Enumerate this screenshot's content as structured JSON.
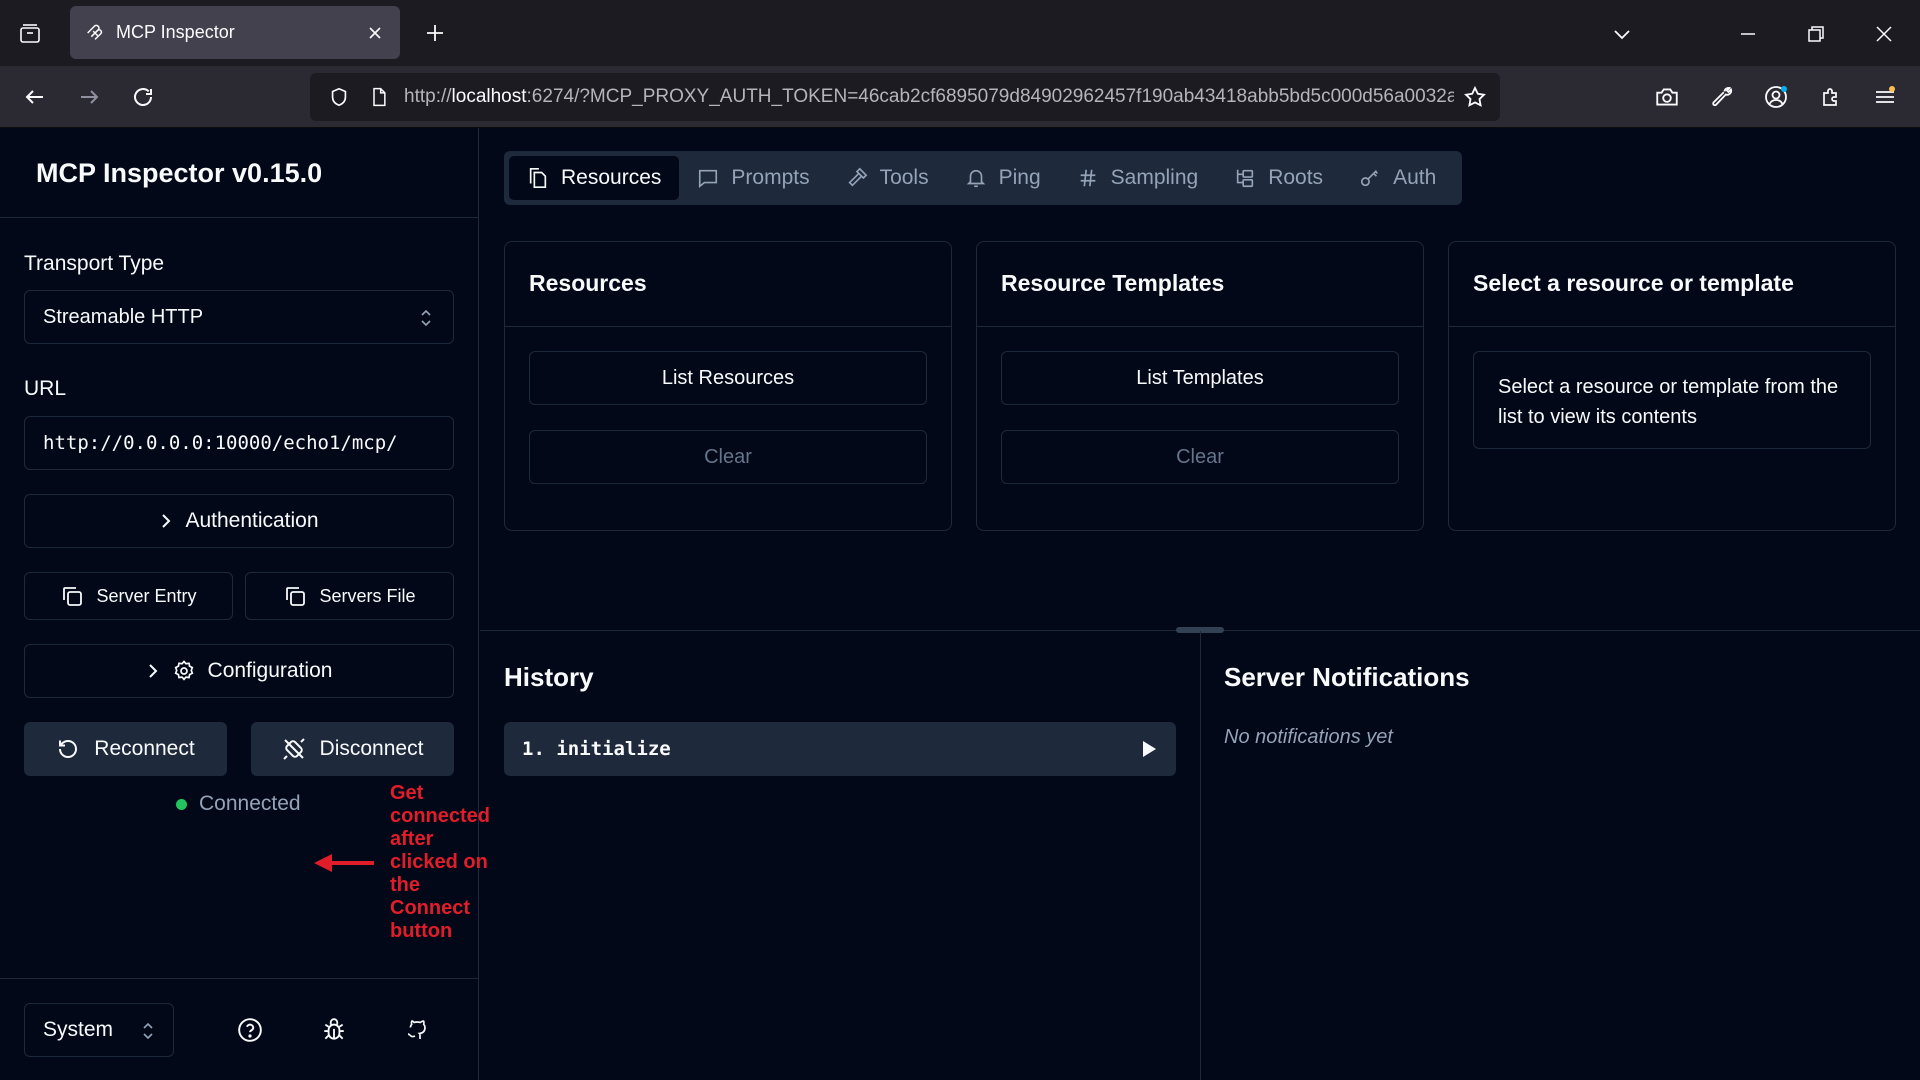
{
  "browser": {
    "tab_title": "MCP Inspector",
    "url_prefix": "http://",
    "url_host": "localhost",
    "url_rest": ":6274/?MCP_PROXY_AUTH_TOKEN=46cab2cf6895079d84902962457f190ab43418abb5bd5c000d56a0032a"
  },
  "sidebar": {
    "title": "MCP Inspector v0.15.0",
    "transport_label": "Transport Type",
    "transport_value": "Streamable HTTP",
    "url_label": "URL",
    "url_value": "http://0.0.0.0:10000/echo1/mcp/",
    "authentication_label": "Authentication",
    "server_entry_label": "Server Entry",
    "servers_file_label": "Servers File",
    "configuration_label": "Configuration",
    "reconnect_label": "Reconnect",
    "disconnect_label": "Disconnect",
    "status_text": "Connected",
    "status_color": "#22c55e",
    "theme_value": "System"
  },
  "annotation": {
    "text": "Get connected after clicked on the Connect button",
    "color": "#e11d2a"
  },
  "tabs": [
    {
      "label": "Resources",
      "icon": "files-icon",
      "active": true
    },
    {
      "label": "Prompts",
      "icon": "message-square-icon"
    },
    {
      "label": "Tools",
      "icon": "hammer-icon"
    },
    {
      "label": "Ping",
      "icon": "bell-icon"
    },
    {
      "label": "Sampling",
      "icon": "hash-icon"
    },
    {
      "label": "Roots",
      "icon": "folder-tree-icon"
    },
    {
      "label": "Auth",
      "icon": "key-icon"
    }
  ],
  "cards": {
    "resources": {
      "title": "Resources",
      "list_label": "List Resources",
      "clear_label": "Clear"
    },
    "templates": {
      "title": "Resource Templates",
      "list_label": "List Templates",
      "clear_label": "Clear"
    },
    "detail": {
      "title": "Select a resource or template",
      "message": "Select a resource or template from the list to view its contents"
    }
  },
  "history": {
    "title": "History",
    "items": [
      "1. initialize"
    ]
  },
  "notifications": {
    "title": "Server Notifications",
    "empty_text": "No notifications yet"
  }
}
